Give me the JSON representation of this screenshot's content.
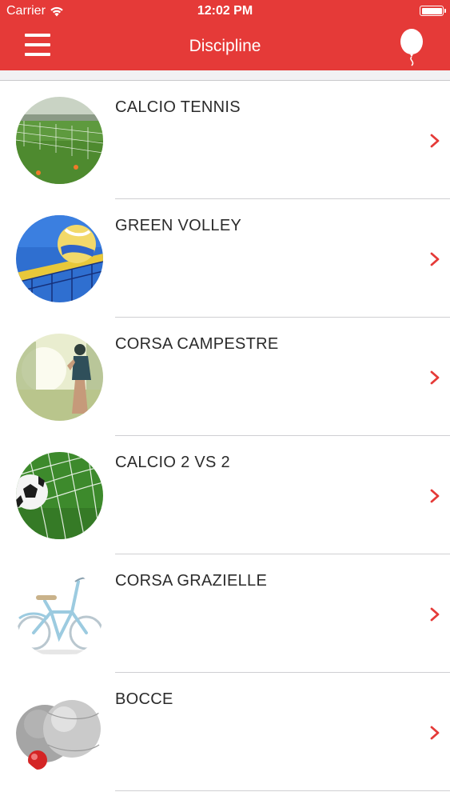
{
  "status_bar": {
    "carrier": "Carrier",
    "time": "12:02 PM",
    "wifi_icon": "wifi-icon",
    "battery_icon": "battery-icon"
  },
  "nav": {
    "title": "Discipline",
    "menu_icon": "hamburger-menu-icon",
    "right_icon": "balloon-icon"
  },
  "colors": {
    "header": "#e53a38",
    "chevron": "#e53a38",
    "label_text": "#2b2b2b",
    "divider": "#cfcfd2"
  },
  "disciplines": [
    {
      "name": "CALCIO TENNIS",
      "image": "calcio-tennis-thumbnail"
    },
    {
      "name": "GREEN VOLLEY",
      "image": "green-volley-thumbnail"
    },
    {
      "name": "CORSA CAMPESTRE",
      "image": "corsa-campestre-thumbnail"
    },
    {
      "name": "CALCIO 2 VS 2",
      "image": "calcio-2vs2-thumbnail"
    },
    {
      "name": "CORSA GRAZIELLE",
      "image": "corsa-grazielle-thumbnail"
    },
    {
      "name": "BOCCE",
      "image": "bocce-thumbnail"
    }
  ]
}
